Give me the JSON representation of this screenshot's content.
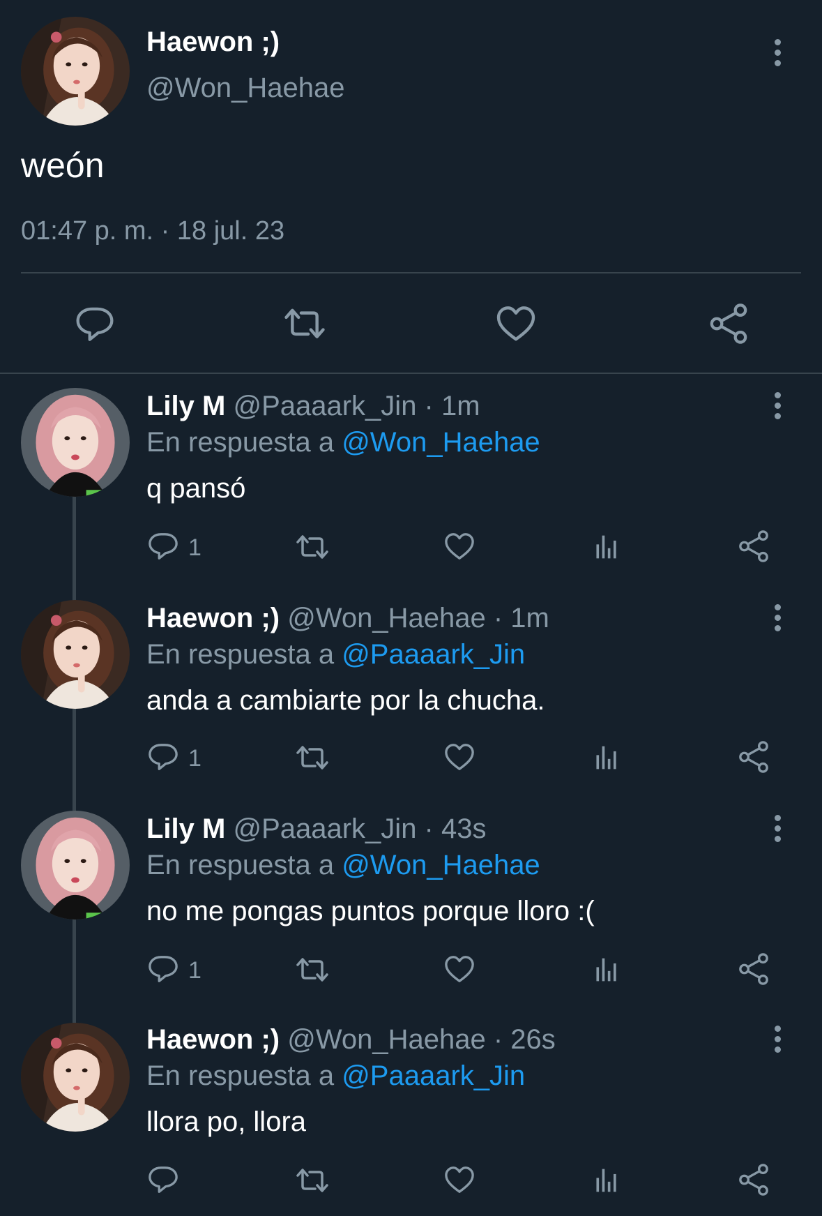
{
  "main_tweet": {
    "display_name": "Haewon ;)",
    "handle": "@Won_Haehae",
    "text": "weón",
    "timestamp": "01:47 p. m. · 18 jul. 23"
  },
  "actions": {
    "reply_icon": "reply-icon",
    "retweet_icon": "retweet-icon",
    "like_icon": "heart-icon",
    "share_icon": "share-icon",
    "views_icon": "views-icon",
    "more_icon": "more-vertical-icon"
  },
  "replies": [
    {
      "display_name": "Lily M",
      "handle_time": "@Paaaark_Jin · 1m",
      "reply_prefix": "En respuesta a",
      "reply_to": "@Won_Haehae",
      "text": "q pansó",
      "reply_count": "1"
    },
    {
      "display_name": "Haewon ;)",
      "handle_time": "@Won_Haehae · 1m",
      "reply_prefix": "En respuesta a",
      "reply_to": "@Paaaark_Jin",
      "text": "anda a cambiarte por la chucha.",
      "reply_count": "1"
    },
    {
      "display_name": "Lily M",
      "handle_time": "@Paaaark_Jin · 43s",
      "reply_prefix": "En respuesta a",
      "reply_to": "@Won_Haehae",
      "text": "no me pongas puntos porque lloro :(",
      "reply_count": "1"
    },
    {
      "display_name": "Haewon ;)",
      "handle_time": "@Won_Haehae · 26s",
      "reply_prefix": "En respuesta a",
      "reply_to": "@Paaaark_Jin",
      "text": "llora po, llora",
      "reply_count": ""
    }
  ],
  "colors": {
    "background": "#15202b",
    "muted": "#8899a6",
    "link": "#1d9bf0",
    "divider": "#38444d"
  }
}
